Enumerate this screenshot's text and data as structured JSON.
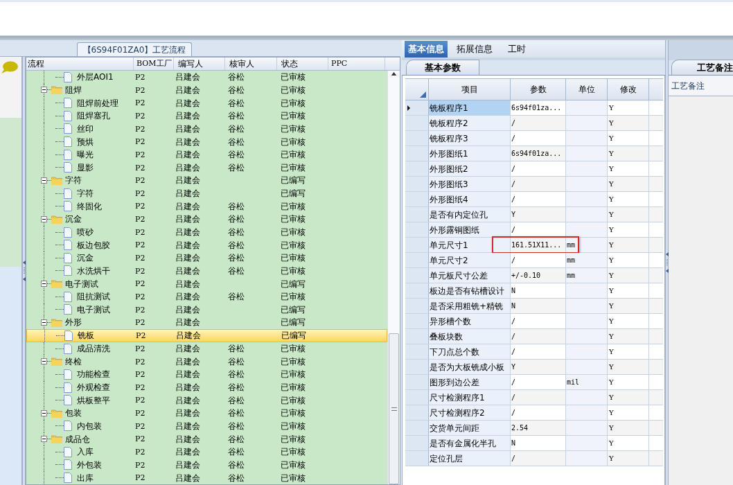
{
  "flow_panel": {
    "title": "【6S94F01ZA0】工艺流程",
    "columns": [
      "流程",
      "BOM工厂",
      "编写人",
      "核审人",
      "状态",
      "PPC"
    ],
    "tree": [
      {
        "kind": "file",
        "name": "外层AOI1",
        "bom": "P2",
        "writer": "吕建会",
        "reviewer": "谷松",
        "status": "已审核",
        "selected": false
      },
      {
        "kind": "folder",
        "name": "阻焊",
        "bom": "P2",
        "writer": "吕建会",
        "reviewer": "谷松",
        "status": "已审核",
        "selected": false,
        "expanded": true,
        "children": [
          {
            "kind": "file",
            "name": "阻焊前处理",
            "bom": "P2",
            "writer": "吕建会",
            "reviewer": "谷松",
            "status": "已审核",
            "selected": false
          },
          {
            "kind": "file",
            "name": "阻焊塞孔",
            "bom": "P2",
            "writer": "吕建会",
            "reviewer": "谷松",
            "status": "已审核",
            "selected": false
          },
          {
            "kind": "file",
            "name": "丝印",
            "bom": "P2",
            "writer": "吕建会",
            "reviewer": "谷松",
            "status": "已审核",
            "selected": false
          },
          {
            "kind": "file",
            "name": "预烘",
            "bom": "P2",
            "writer": "吕建会",
            "reviewer": "谷松",
            "status": "已审核",
            "selected": false
          },
          {
            "kind": "file",
            "name": "曝光",
            "bom": "P2",
            "writer": "吕建会",
            "reviewer": "谷松",
            "status": "已审核",
            "selected": false
          },
          {
            "kind": "file",
            "name": "显影",
            "bom": "P2",
            "writer": "吕建会",
            "reviewer": "谷松",
            "status": "已审核",
            "selected": false
          }
        ]
      },
      {
        "kind": "folder",
        "name": "字符",
        "bom": "P2",
        "writer": "吕建会",
        "status": "已编写",
        "selected": false,
        "expanded": true,
        "children": [
          {
            "kind": "file",
            "name": "字符",
            "bom": "P2",
            "writer": "吕建会",
            "status": "已编写",
            "selected": false
          },
          {
            "kind": "file",
            "name": "终固化",
            "bom": "P2",
            "writer": "吕建会",
            "reviewer": "谷松",
            "status": "已审核",
            "selected": false
          }
        ]
      },
      {
        "kind": "folder",
        "name": "沉金",
        "bom": "P2",
        "writer": "吕建会",
        "reviewer": "谷松",
        "status": "已审核",
        "selected": false,
        "expanded": true,
        "children": [
          {
            "kind": "file",
            "name": "喷砂",
            "bom": "P2",
            "writer": "吕建会",
            "reviewer": "谷松",
            "status": "已审核",
            "selected": false
          },
          {
            "kind": "file",
            "name": "板边包胶",
            "bom": "P2",
            "writer": "吕建会",
            "reviewer": "谷松",
            "status": "已审核",
            "selected": false
          },
          {
            "kind": "file",
            "name": "沉金",
            "bom": "P2",
            "writer": "吕建会",
            "reviewer": "谷松",
            "status": "已审核",
            "selected": false
          },
          {
            "kind": "file",
            "name": "水洗烘干",
            "bom": "P2",
            "writer": "吕建会",
            "reviewer": "谷松",
            "status": "已审核",
            "selected": false
          }
        ]
      },
      {
        "kind": "folder",
        "name": "电子测试",
        "bom": "P2",
        "writer": "吕建会",
        "status": "已编写",
        "selected": false,
        "expanded": true,
        "children": [
          {
            "kind": "file",
            "name": "阻抗测试",
            "bom": "P2",
            "writer": "吕建会",
            "reviewer": "谷松",
            "status": "已审核",
            "selected": false
          },
          {
            "kind": "file",
            "name": "电子测试",
            "bom": "P2",
            "writer": "吕建会",
            "status": "已编写",
            "selected": false
          }
        ]
      },
      {
        "kind": "folder",
        "name": "外形",
        "bom": "P2",
        "writer": "吕建会",
        "status": "已编写",
        "selected": false,
        "expanded": true,
        "children": [
          {
            "kind": "file",
            "name": "铣板",
            "bom": "P2",
            "writer": "吕建会",
            "status": "已编写",
            "selected": true
          },
          {
            "kind": "file",
            "name": "成品清洗",
            "bom": "P2",
            "writer": "吕建会",
            "reviewer": "谷松",
            "status": "已审核",
            "selected": false
          }
        ]
      },
      {
        "kind": "folder",
        "name": "终检",
        "bom": "P2",
        "writer": "吕建会",
        "reviewer": "谷松",
        "status": "已审核",
        "selected": false,
        "expanded": true,
        "children": [
          {
            "kind": "file",
            "name": "功能检查",
            "bom": "P2",
            "writer": "吕建会",
            "reviewer": "谷松",
            "status": "已审核",
            "selected": false
          },
          {
            "kind": "file",
            "name": "外观检查",
            "bom": "P2",
            "writer": "吕建会",
            "reviewer": "谷松",
            "status": "已审核",
            "selected": false
          },
          {
            "kind": "file",
            "name": "烘板整平",
            "bom": "P2",
            "writer": "吕建会",
            "reviewer": "谷松",
            "status": "已审核",
            "selected": false
          }
        ]
      },
      {
        "kind": "folder",
        "name": "包装",
        "bom": "P2",
        "writer": "吕建会",
        "reviewer": "谷松",
        "status": "已审核",
        "selected": false,
        "expanded": true,
        "children": [
          {
            "kind": "file",
            "name": "内包装",
            "bom": "P2",
            "writer": "吕建会",
            "reviewer": "谷松",
            "status": "已审核",
            "selected": false
          }
        ]
      },
      {
        "kind": "folder",
        "name": "成品仓",
        "bom": "P2",
        "writer": "吕建会",
        "reviewer": "谷松",
        "status": "已审核",
        "selected": false,
        "expanded": true,
        "children": [
          {
            "kind": "file",
            "name": "入库",
            "bom": "P2",
            "writer": "吕建会",
            "reviewer": "谷松",
            "status": "已审核",
            "selected": false
          },
          {
            "kind": "file",
            "name": "外包装",
            "bom": "P2",
            "writer": "吕建会",
            "reviewer": "谷松",
            "status": "已审核",
            "selected": false
          },
          {
            "kind": "file",
            "name": "出库",
            "bom": "P2",
            "writer": "吕建会",
            "reviewer": "谷松",
            "status": "已审核",
            "selected": false
          }
        ]
      }
    ]
  },
  "info_panel": {
    "tabs": [
      {
        "label": "基本信息",
        "selected": true
      },
      {
        "label": "拓展信息",
        "selected": false
      },
      {
        "label": "工时",
        "selected": false
      }
    ],
    "section_tab": "基本参数",
    "columns": [
      "项目",
      "参数",
      "单位",
      "修改"
    ],
    "rows": [
      {
        "item": "铣板程序1",
        "param": "6s94f01za...",
        "modify": "Y",
        "selected": true,
        "highlighted": false
      },
      {
        "item": "铣板程序2",
        "param": "/",
        "modify": "Y",
        "selected": false,
        "highlighted": false
      },
      {
        "item": "铣板程序3",
        "param": "/",
        "modify": "Y",
        "selected": false,
        "highlighted": false
      },
      {
        "item": "外形图纸1",
        "param": "6s94f01za...",
        "modify": "Y",
        "selected": false,
        "highlighted": false
      },
      {
        "item": "外形图纸2",
        "param": "/",
        "modify": "Y",
        "selected": false,
        "highlighted": false
      },
      {
        "item": "外形图纸3",
        "param": "/",
        "modify": "Y",
        "selected": false,
        "highlighted": false
      },
      {
        "item": "外形图纸4",
        "param": "/",
        "modify": "Y",
        "selected": false,
        "highlighted": false
      },
      {
        "item": "是否有内定位孔",
        "param": "Y",
        "modify": "Y",
        "selected": false,
        "highlighted": false
      },
      {
        "item": "外形露铜图纸",
        "param": "/",
        "modify": "Y",
        "selected": false,
        "highlighted": false
      },
      {
        "item": "单元尺寸1",
        "param": "161.51X11...",
        "unit": "mm",
        "modify": "Y",
        "selected": false,
        "highlighted": true
      },
      {
        "item": "单元尺寸2",
        "param": "/",
        "unit": "mm",
        "modify": "Y",
        "selected": false,
        "highlighted": false
      },
      {
        "item": "单元板尺寸公差",
        "param": "+/-0.10",
        "unit": "mm",
        "modify": "Y",
        "selected": false,
        "highlighted": false
      },
      {
        "item": "板边是否有钻槽设计",
        "param": "N",
        "modify": "Y",
        "selected": false,
        "highlighted": false
      },
      {
        "item": "是否采用粗铣+精铣",
        "param": "N",
        "modify": "Y",
        "selected": false,
        "highlighted": false
      },
      {
        "item": "异形槽个数",
        "param": "/",
        "modify": "Y",
        "selected": false,
        "highlighted": false
      },
      {
        "item": "叠板块数",
        "param": "/",
        "modify": "Y",
        "selected": false,
        "highlighted": false
      },
      {
        "item": "下刀点总个数",
        "param": "/",
        "modify": "Y",
        "selected": false,
        "highlighted": false
      },
      {
        "item": "是否为大板铣成小板",
        "param": "Y",
        "modify": "Y",
        "selected": false,
        "highlighted": false
      },
      {
        "item": "图形到边公差",
        "param": "/",
        "unit": "mil",
        "modify": "Y",
        "selected": false,
        "highlighted": false
      },
      {
        "item": "尺寸检测程序1",
        "param": "/",
        "modify": "Y",
        "selected": false,
        "highlighted": false
      },
      {
        "item": "尺寸检测程序2",
        "param": "/",
        "modify": "Y",
        "selected": false,
        "highlighted": false
      },
      {
        "item": "交货单元间距",
        "param": "2.54",
        "modify": "Y",
        "selected": false,
        "highlighted": false
      },
      {
        "item": "是否有金属化半孔",
        "param": "N",
        "modify": "Y",
        "selected": false,
        "highlighted": false
      },
      {
        "item": "定位孔层",
        "param": "/",
        "modify": "Y",
        "selected": false,
        "highlighted": false
      }
    ]
  },
  "remarks_panel": {
    "tab": "工艺备注",
    "label": "工艺备注"
  }
}
